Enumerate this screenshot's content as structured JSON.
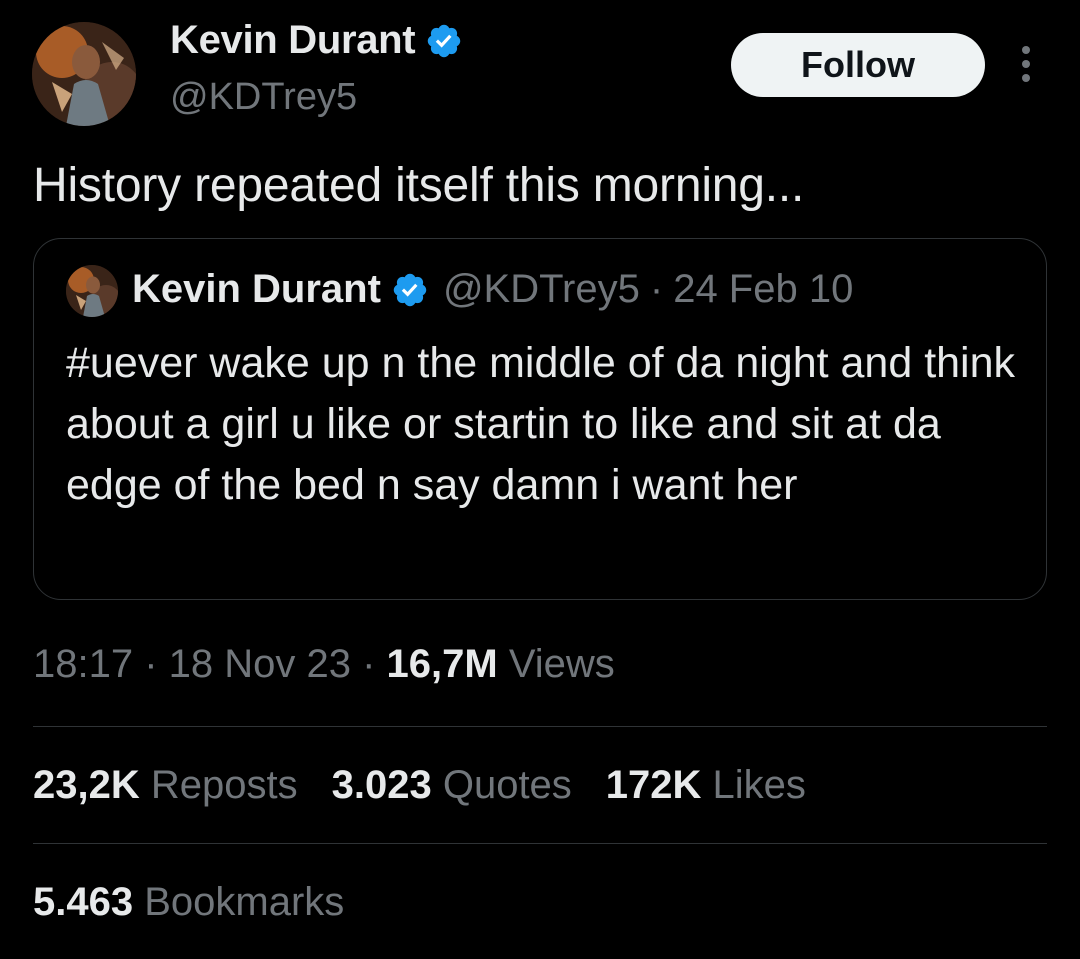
{
  "author": {
    "display_name": "Kevin Durant",
    "handle": "@KDTrey5",
    "verified_icon": "verified-badge-icon",
    "badge_color": "#1d9bf0"
  },
  "actions": {
    "follow_label": "Follow",
    "more_icon": "more-vertical-icon"
  },
  "tweet": {
    "text": "History repeated itself this morning..."
  },
  "quoted": {
    "display_name": "Kevin Durant",
    "handle": "@KDTrey5",
    "separator": "·",
    "date": "24 Feb 10",
    "text": "#uever wake up n the middle of da night and think about a girl u like or startin to like and sit at da edge of the bed n say damn i want her"
  },
  "meta": {
    "time": "18:17",
    "sep1": " · ",
    "date": "18 Nov 23",
    "sep2": " · ",
    "views_count": "16,7M",
    "views_label": " Views"
  },
  "stats": {
    "reposts_count": "23,2K",
    "reposts_label": " Reposts",
    "quotes_count": "3.023",
    "quotes_label": " Quotes",
    "likes_count": "172K",
    "likes_label": " Likes",
    "bookmarks_count": "5.463",
    "bookmarks_label": " Bookmarks"
  }
}
